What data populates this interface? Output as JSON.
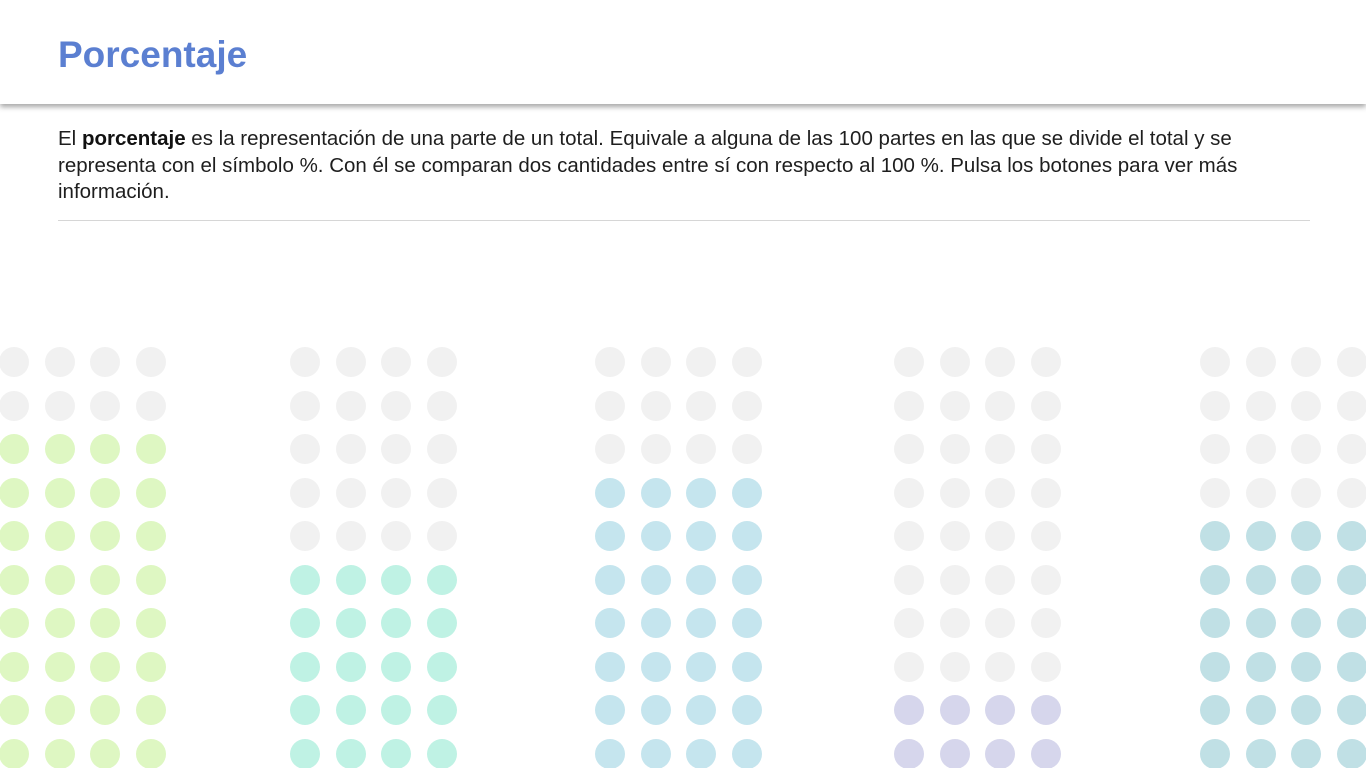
{
  "header": {
    "title": "Porcentaje"
  },
  "intro": {
    "prefix": "El ",
    "bold": "porcentaje",
    "suffix": " es la representación de una parte de un total. Equivale a alguna de las 100 partes en las que se divide el total y se representa con el símbolo %. Con él se comparan dos cantidades entre sí con respecto al 100 %. Pulsa los botones para ver más información."
  },
  "colors": {
    "empty": "#f1f1f1",
    "title": "#5b7fd1"
  },
  "dot_groups": [
    {
      "filled_rows": 8,
      "color": "#def7c2"
    },
    {
      "filled_rows": 5,
      "color": "#bff2e4"
    },
    {
      "filled_rows": 7,
      "color": "#c5e5ee"
    },
    {
      "filled_rows": 2,
      "color": "#d6d6ec"
    },
    {
      "filled_rows": 6,
      "color": "#c0e0e5"
    }
  ]
}
